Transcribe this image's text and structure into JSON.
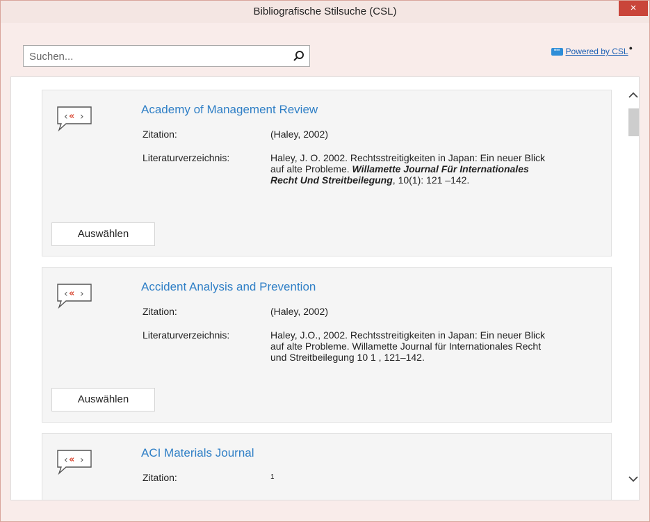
{
  "window": {
    "title": "Bibliografische Stilsuche (CSL)",
    "close_label": "×"
  },
  "search": {
    "placeholder": "Suchen...",
    "value": ""
  },
  "powered_by": {
    "logo_text": "\"\"",
    "link_label": "Powered by CSL"
  },
  "styles": [
    {
      "title": "Academy of Management Review",
      "citation_label": "Zitation:",
      "citation": "(Haley, 2002)",
      "bibliography_label": "Literaturverzeichnis:",
      "bibliography_pre": "Haley, J. O. 2002. Rechtsstreitigkeiten in Japan: Ein neuer Blick auf alte Probleme. ",
      "bibliography_journal": "Willamette Journal Für Internationales Recht Und Streitbeilegung",
      "bibliography_post": ", 10(1): 121 –142.",
      "select_label": "Auswählen"
    },
    {
      "title": "Accident Analysis and Prevention",
      "citation_label": "Zitation:",
      "citation": "(Haley, 2002)",
      "bibliography_label": "Literaturverzeichnis:",
      "bibliography": "Haley, J.O., 2002. Rechtsstreitigkeiten in Japan: Ein neuer Blick auf alte Probleme. Willamette Journal für Internationales Recht und Streitbeilegung 10 1 , 121–142.",
      "select_label": "Auswählen"
    },
    {
      "title": "ACI Materials Journal",
      "citation_label": "Zitation:",
      "citation": "1"
    }
  ],
  "colors": {
    "accent": "#2f7fc6",
    "close": "#c9453a",
    "background": "#f9ecea"
  }
}
